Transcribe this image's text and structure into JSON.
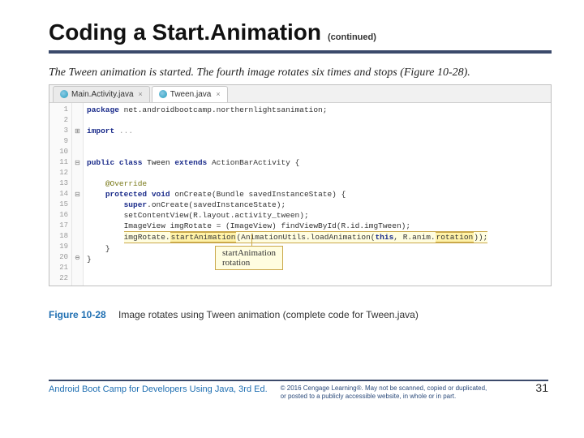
{
  "header": {
    "title": "Coding a Start.Animation",
    "continued": "(continued)"
  },
  "intro": "The Tween animation is started. The fourth image rotates six times and stops (Figure 10-28).",
  "ide": {
    "tabs": [
      {
        "label": "Main.Activity.java",
        "active": false
      },
      {
        "label": "Tween.java",
        "active": true
      }
    ],
    "gutter": [
      "1",
      "2",
      "3",
      "9",
      "10",
      "11",
      "12",
      "13",
      "14",
      "15",
      "16",
      "17",
      "18",
      "19",
      "20",
      "21",
      "22"
    ]
  },
  "code": {
    "l1_pkg": "package",
    "l1_rest": " net.androidbootcamp.northernlightsanimation;",
    "l3_imp": "import",
    "l3_rest": " ...",
    "l11_a": "public class",
    "l11_b": " Tween ",
    "l11_c": "extends",
    "l11_d": " ActionBarActivity {",
    "l13": "@Override",
    "l14_a": "protected void",
    "l14_b": " onCreate(Bundle savedInstanceState) {",
    "l15_a": "super",
    "l15_b": ".onCreate(savedInstanceState);",
    "l16": "setContentView(R.layout.activity_tween);",
    "l17": "ImageView imgRotate = (ImageView) findViewById(R.id.imgTween);",
    "l18_a": "imgRotate.",
    "l18_b": "startAnimation",
    "l18_c": "(AnimationUtils.loadAnimation(",
    "l18_d": "this",
    "l18_e": ", R.anim.",
    "l18_f": "rotation",
    "l18_g": "));",
    "l19": "}",
    "l20": "}"
  },
  "callout": {
    "line1": "startAnimation",
    "line2": "rotation"
  },
  "figure": {
    "num": "Figure 10-28",
    "caption": "Image rotates using Tween animation (complete code for Tween.java)"
  },
  "footer": {
    "book": "Android Boot Camp for Developers Using Java, 3rd Ed.",
    "copyright": "© 2016 Cengage Learning®. May not be scanned, copied or duplicated, or posted to a publicly accessible website, in whole or in part.",
    "page": "31"
  }
}
